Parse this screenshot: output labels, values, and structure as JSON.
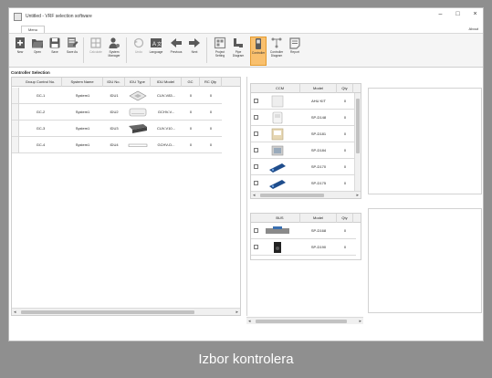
{
  "window": {
    "title": "Untitled - VRF selection software",
    "minimize": "–",
    "maximize": "□",
    "close": "×"
  },
  "menu": {
    "tab": "Menu",
    "about": "About"
  },
  "toolbar": [
    {
      "label": "New",
      "icon": "new-file-icon"
    },
    {
      "label": "Open",
      "icon": "folder-open-icon"
    },
    {
      "label": "Save",
      "icon": "save-icon"
    },
    {
      "label": "Save As",
      "icon": "save-as-icon"
    },
    {
      "label": "Calculate",
      "icon": "calculator-icon",
      "disabled": true
    },
    {
      "label": "System Manager",
      "icon": "system-manager-icon"
    },
    {
      "label": "Undo",
      "icon": "undo-icon",
      "disabled": true
    },
    {
      "label": "Language",
      "icon": "language-icon"
    },
    {
      "label": "Previous",
      "icon": "arrow-left-icon"
    },
    {
      "label": "Next",
      "icon": "arrow-right-icon"
    },
    {
      "label": "Project Setting",
      "icon": "project-setting-icon"
    },
    {
      "label": "Pipe Diagram",
      "icon": "pipe-diagram-icon"
    },
    {
      "label": "Controller",
      "icon": "controller-icon",
      "active": true
    },
    {
      "label": "Controller Diagram",
      "icon": "controller-diagram-icon"
    },
    {
      "label": "Report",
      "icon": "report-icon"
    }
  ],
  "section_title": "Controller Selection",
  "group_table": {
    "columns": [
      "Group Control No.",
      "System Name",
      "IDU No.",
      "IDU Type",
      "IDU Model",
      "GC",
      "RC Qty"
    ],
    "rows": [
      {
        "group": "GC-1",
        "system": "System1",
        "idu_no": "IDU1",
        "idu_type": "cassette-unit-icon",
        "idu_model": "CUV-V83...",
        "gc": "0",
        "rc_qty": "0"
      },
      {
        "group": "GC-2",
        "system": "System1",
        "idu_no": "IDU2",
        "idu_type": "wall-unit-icon",
        "idu_model": "GCHV-V...",
        "gc": "0",
        "rc_qty": "0"
      },
      {
        "group": "GC-3",
        "system": "System1",
        "idu_no": "IDU3",
        "idu_type": "ducted-unit-icon",
        "idu_model": "CUV-V10...",
        "gc": "0",
        "rc_qty": "0"
      },
      {
        "group": "GC-4",
        "system": "System1",
        "idu_no": "IDU4",
        "idu_type": "slim-duct-icon",
        "idu_model": "GCHV-D...",
        "gc": "0",
        "rc_qty": "0"
      }
    ]
  },
  "ccm_table": {
    "columns": [
      "CCM",
      "Model",
      "Qty"
    ],
    "rows": [
      {
        "icon": "ahu-kit-icon",
        "model": "AHU KIT",
        "qty": "0"
      },
      {
        "icon": "wired-controller-icon",
        "model": "SP-D148",
        "qty": "0"
      },
      {
        "icon": "central-controller-icon",
        "model": "SP-D181",
        "qty": "0"
      },
      {
        "icon": "touch-panel-icon",
        "model": "SP-D184",
        "qty": "0"
      },
      {
        "icon": "remote-blue-icon",
        "model": "SP-D170",
        "qty": "0"
      },
      {
        "icon": "remote-blue-icon",
        "model": "SP-D175",
        "qty": "0"
      }
    ]
  },
  "bus_table": {
    "columns": [
      "BUS",
      "Model",
      "Qty"
    ],
    "rows": [
      {
        "icon": "bus-adapter-icon",
        "model": "SP-D168",
        "qty": "0"
      },
      {
        "icon": "bus-module-icon",
        "model": "SP-D190",
        "qty": "0"
      }
    ]
  },
  "caption": "Izbor kontrolera",
  "colors": {
    "active_tool": "#f9c06e",
    "toolbar_icon": "#5a5a5a",
    "caption_bg": "#8f8f8f"
  }
}
